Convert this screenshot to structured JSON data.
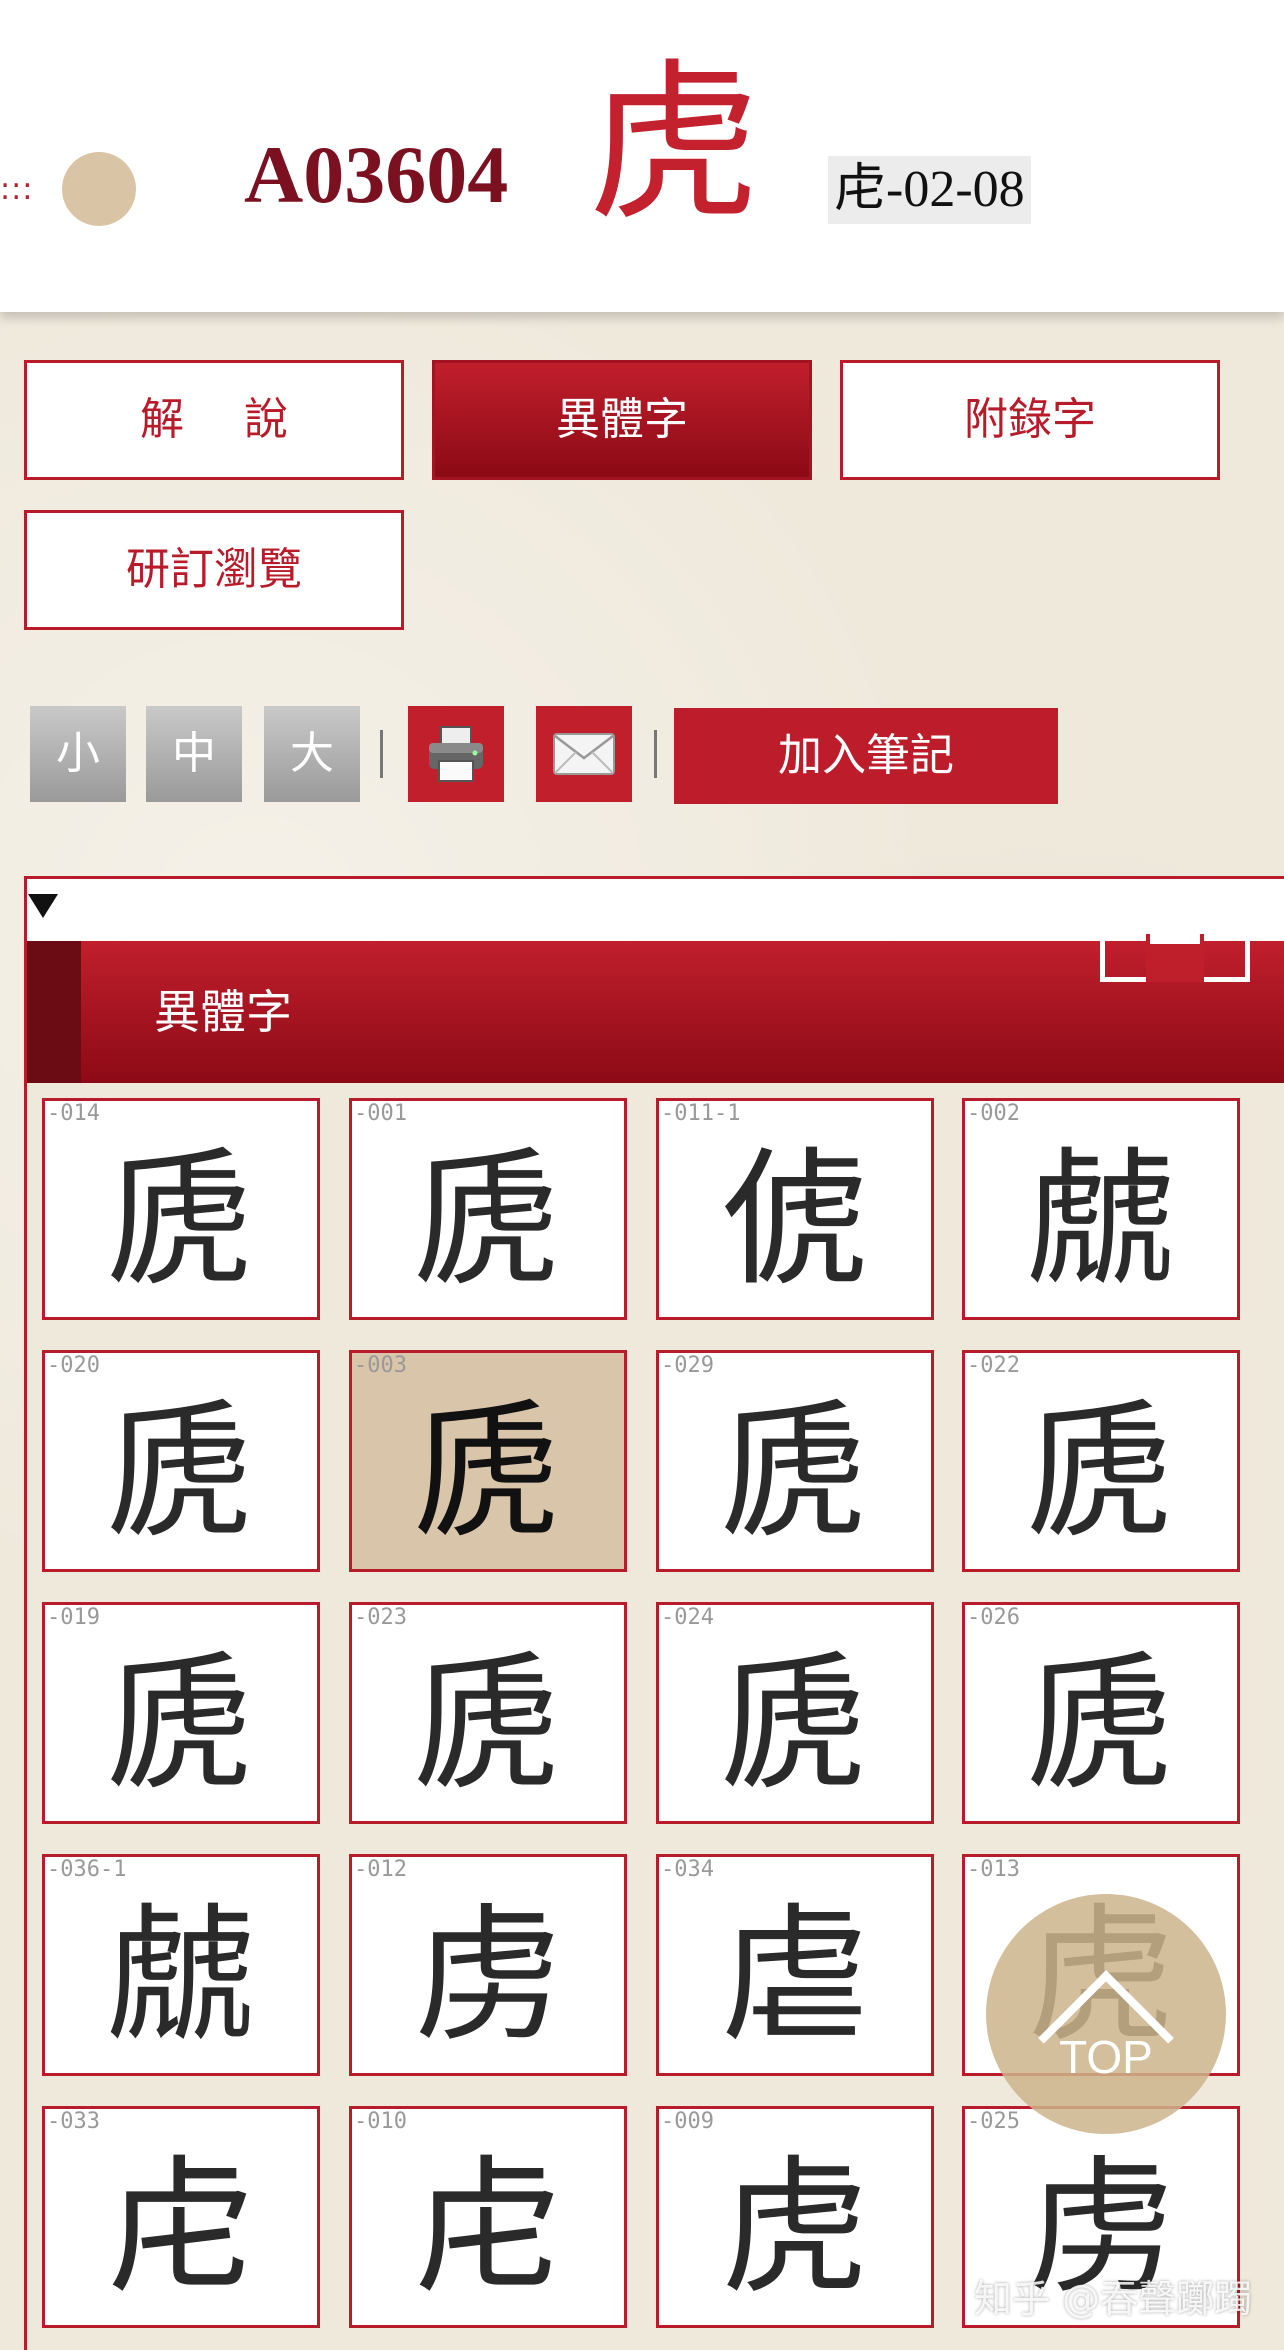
{
  "header": {
    "dots": ":::",
    "code": "A03604",
    "character": "虎",
    "radical_tag": "虍-02-08"
  },
  "tabs": [
    {
      "label": "解說",
      "active": false
    },
    {
      "label": "異體字",
      "active": true
    },
    {
      "label": "附錄字",
      "active": false
    },
    {
      "label": "研訂瀏覽",
      "active": false
    }
  ],
  "toolbar": {
    "size_small": "小",
    "size_medium": "中",
    "size_large": "大",
    "separator": "|",
    "print_icon": "printer-icon",
    "mail_icon": "mail-icon",
    "add_note": "加入筆記"
  },
  "panel": {
    "title": "異體字"
  },
  "variants": [
    {
      "id": "-014",
      "glyph": "虒"
    },
    {
      "id": "-001",
      "glyph": "虒"
    },
    {
      "id": "-011-1",
      "glyph": "俿"
    },
    {
      "id": "-002",
      "glyph": "虤"
    },
    {
      "id": "-020",
      "glyph": "虒"
    },
    {
      "id": "-003",
      "glyph": "虒",
      "selected": true
    },
    {
      "id": "-029",
      "glyph": "虒"
    },
    {
      "id": "-022",
      "glyph": "虒"
    },
    {
      "id": "-019",
      "glyph": "虒"
    },
    {
      "id": "-023",
      "glyph": "虒"
    },
    {
      "id": "-024",
      "glyph": "虒"
    },
    {
      "id": "-026",
      "glyph": "虒"
    },
    {
      "id": "-036-1",
      "glyph": "虤"
    },
    {
      "id": "-012",
      "glyph": "虏"
    },
    {
      "id": "-034",
      "glyph": "虐"
    },
    {
      "id": "-013",
      "glyph": "虎"
    },
    {
      "id": "-033",
      "glyph": "虍"
    },
    {
      "id": "-010",
      "glyph": "虍"
    },
    {
      "id": "-009",
      "glyph": "虎"
    },
    {
      "id": "-025",
      "glyph": "虏"
    }
  ],
  "top_button": {
    "label": "TOP"
  },
  "watermark": "知乎 @吞聲躑躅",
  "colors": {
    "accent": "#b81c2a",
    "selected_bg": "#d9c5a9",
    "circle": "#d9c5a6"
  }
}
